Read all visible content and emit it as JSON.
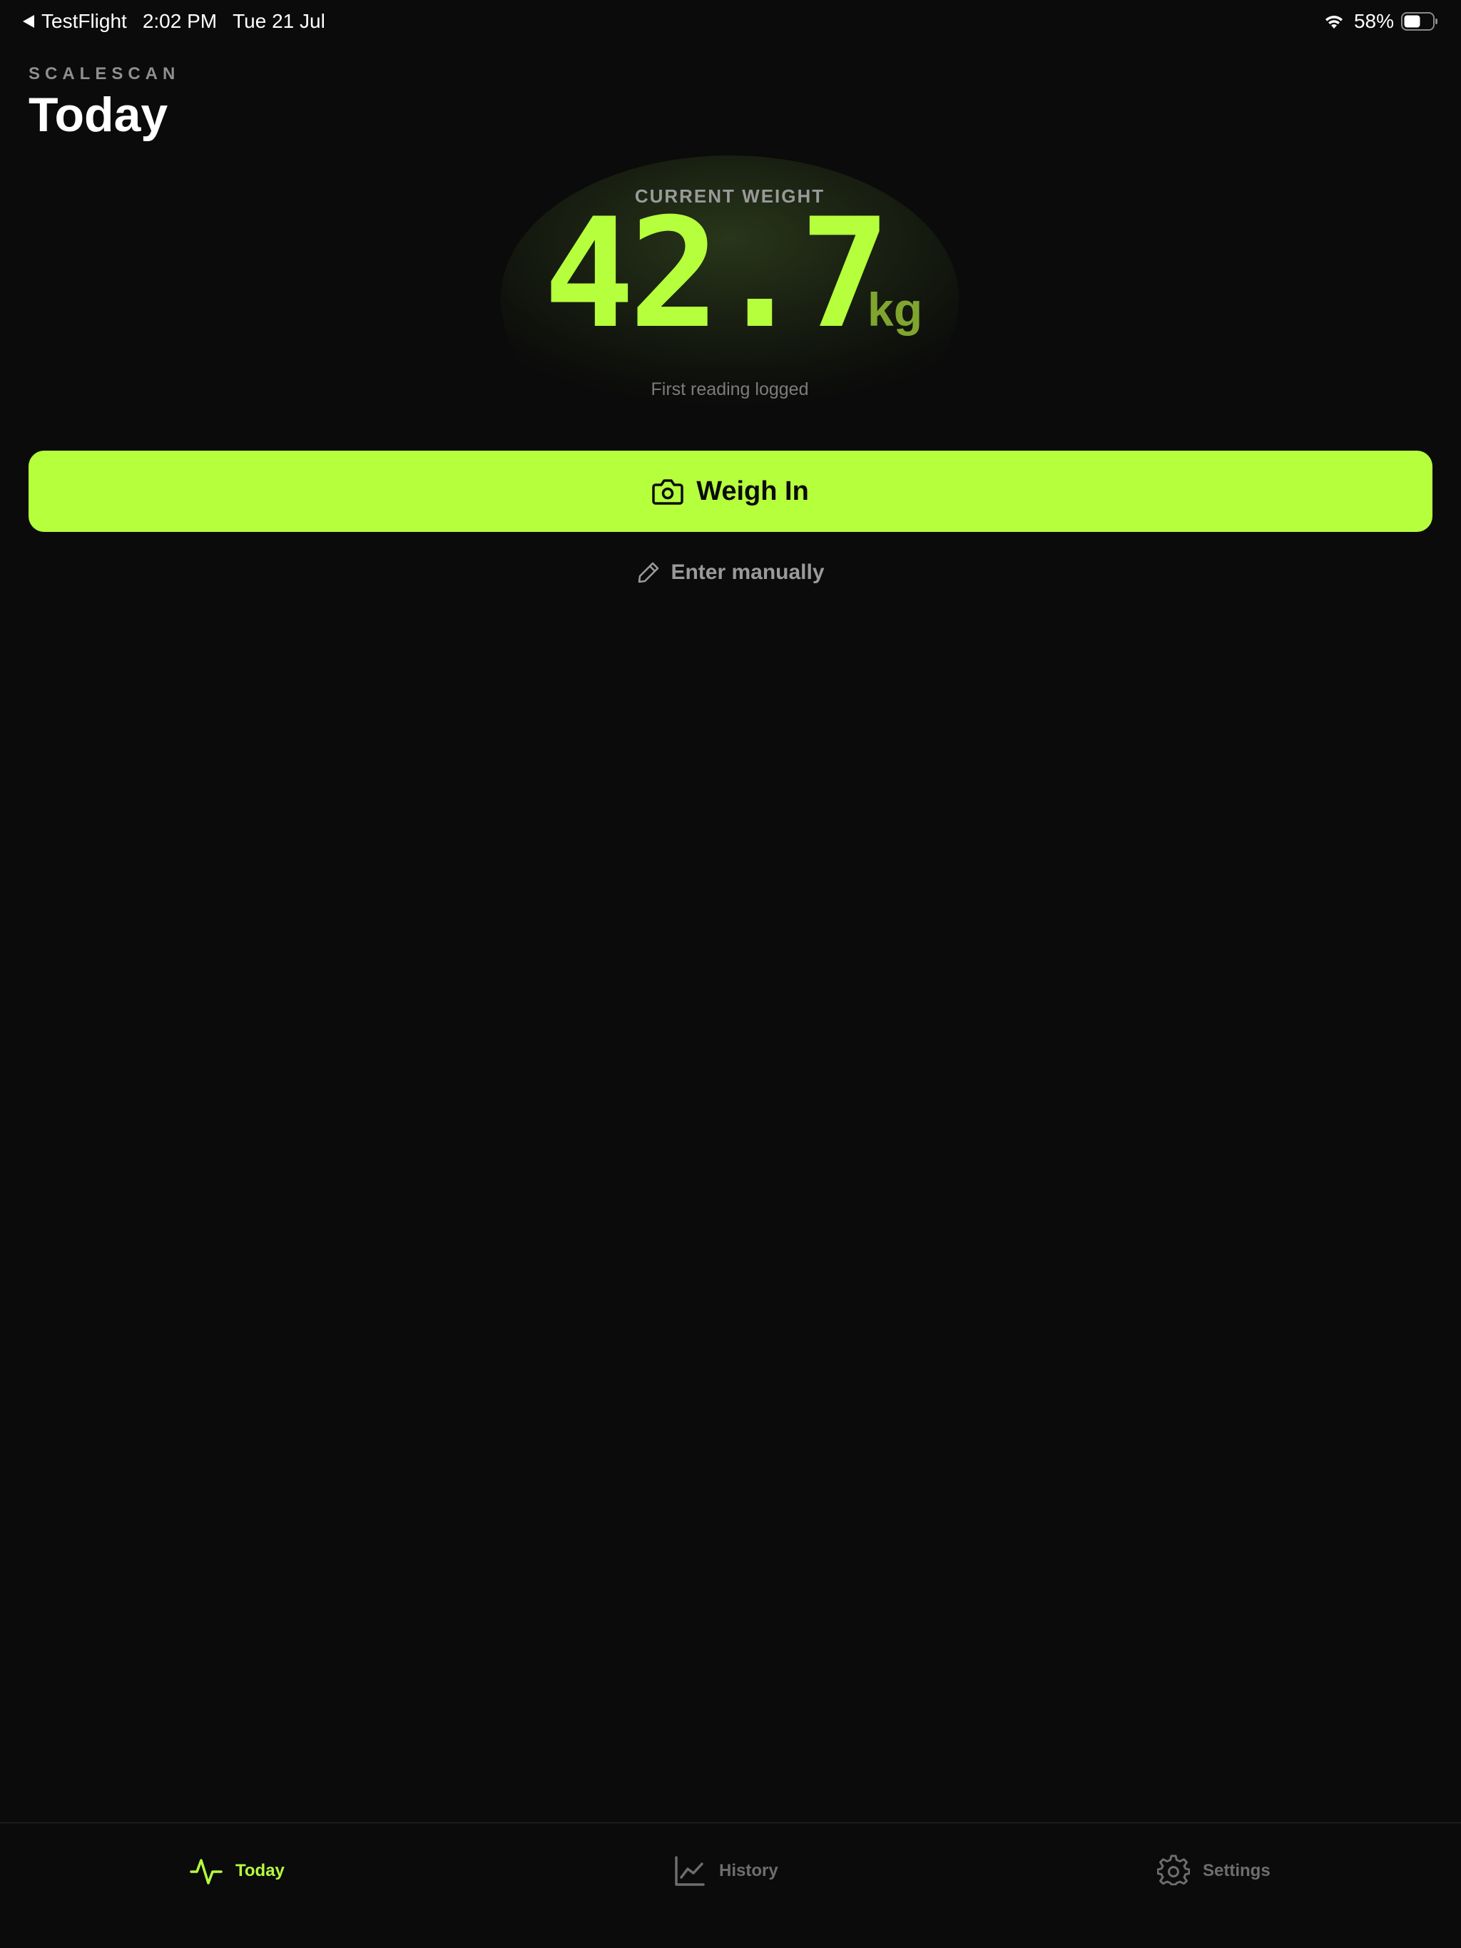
{
  "status_bar": {
    "back_app": "TestFlight",
    "time": "2:02 PM",
    "date": "Tue 21 Jul",
    "battery": "58%"
  },
  "header": {
    "app_name": "SCALESCAN",
    "title": "Today"
  },
  "weight_card": {
    "label": "CURRENT WEIGHT",
    "value": "42.7",
    "unit": "kg",
    "caption": "First reading logged"
  },
  "actions": {
    "weigh_in_label": "Weigh In",
    "manual_label": "Enter manually"
  },
  "tabs": [
    {
      "label": "Today",
      "icon": "activity-icon",
      "active": true
    },
    {
      "label": "History",
      "icon": "chart-icon",
      "active": false
    },
    {
      "label": "Settings",
      "icon": "gear-icon",
      "active": false
    }
  ],
  "colors": {
    "accent": "#b5ff3d",
    "background": "#0b0b0b",
    "muted": "#9a9a9a"
  }
}
